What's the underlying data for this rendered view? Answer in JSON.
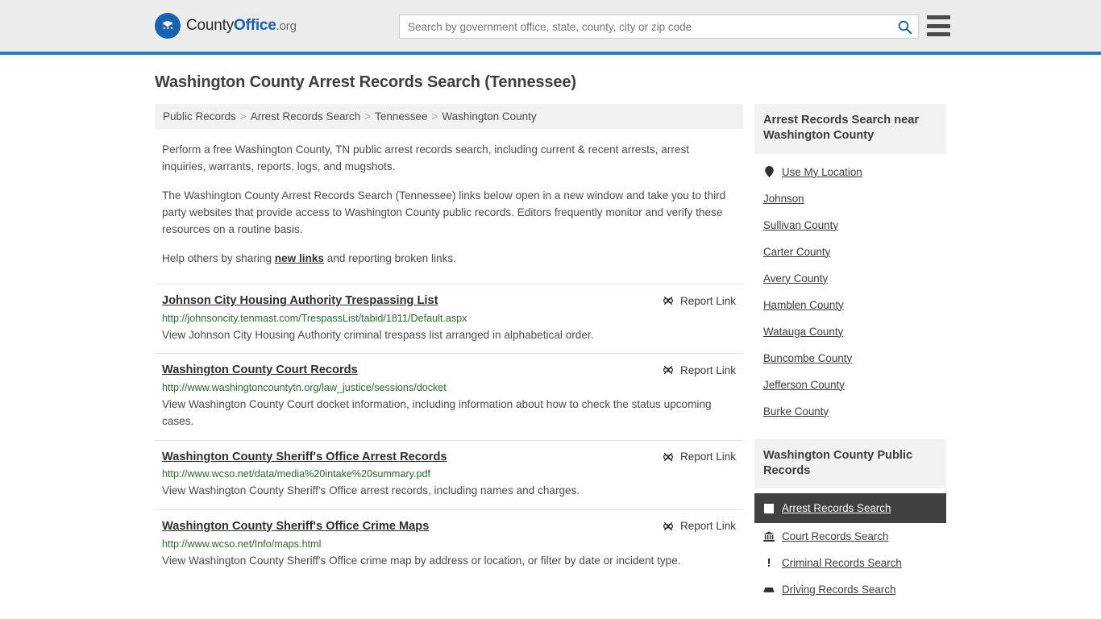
{
  "header": {
    "logo": {
      "part1": "County",
      "part2": "Office",
      "part3": ".org",
      "icon": "eagle-shield-icon"
    },
    "search": {
      "placeholder": "Search by government office, state, county, city or zip code",
      "value": "",
      "icon": "search-icon"
    },
    "menu_icon": "hamburger-menu-icon",
    "accent_color": "#3d72a4",
    "background_color": "#ececec"
  },
  "page": {
    "title": "Washington County Arrest Records Search (Tennessee)"
  },
  "breadcrumb": {
    "separator": ">",
    "items": [
      {
        "label": "Public Records"
      },
      {
        "label": "Arrest Records Search"
      },
      {
        "label": "Tennessee"
      },
      {
        "label": "Washington County"
      }
    ]
  },
  "intro": {
    "p1": "Perform a free Washington County, TN public arrest records search, including current & recent arrests, arrest inquiries, warrants, reports, logs, and mugshots.",
    "p2": "The Washington County Arrest Records Search (Tennessee) links below open in a new window and take you to third party websites that provide access to Washington County public records. Editors frequently monitor and verify these resources on a routine basis.",
    "p3_before": "Help others by sharing ",
    "p3_link": "new links",
    "p3_after": " and reporting broken links."
  },
  "results": {
    "report_label": "Report Link",
    "report_icon": "broken-link-icon",
    "items": [
      {
        "title": "Johnson City Housing Authority Trespassing List",
        "url": "http://johnsoncity.tenmast.com/TrespassList/tabid/1811/Default.aspx",
        "description": "View Johnson City Housing Authority criminal trespass list arranged in alphabetical order."
      },
      {
        "title": "Washington County Court Records",
        "url": "http://www.washingtoncountytn.org/law_justice/sessions/docket",
        "description": "View Washington County Court docket information, including information about how to check the status upcoming cases."
      },
      {
        "title": "Washington County Sheriff's Office Arrest Records",
        "url": "http://www.wcso.net/data/media%20intake%20summary.pdf",
        "description": "View Washington County Sheriff's Office arrest records, including names and charges."
      },
      {
        "title": "Washington County Sheriff's Office Crime Maps",
        "url": "http://www.wcso.net/Info/maps.html",
        "description": "View Washington County Sheriff's Office crime map by address or location, or filter by date or incident type."
      }
    ]
  },
  "sidebar": {
    "near": {
      "heading": "Arrest Records Search near Washington County",
      "use_my_location": {
        "label": "Use My Location",
        "icon": "map-pin-icon"
      },
      "items": [
        {
          "label": "Johnson"
        },
        {
          "label": "Sullivan County"
        },
        {
          "label": "Carter County"
        },
        {
          "label": "Avery County"
        },
        {
          "label": "Hamblen County"
        },
        {
          "label": "Watauga County"
        },
        {
          "label": "Buncombe County"
        },
        {
          "label": "Jefferson County"
        },
        {
          "label": "Burke County"
        }
      ]
    },
    "public_records": {
      "heading": "Washington County Public Records",
      "items": [
        {
          "label": "Arrest Records Search",
          "icon": "square-icon",
          "active": true
        },
        {
          "label": "Court Records Search",
          "icon": "courthouse-icon",
          "active": false
        },
        {
          "label": "Criminal Records Search",
          "icon": "exclamation-icon",
          "active": false
        },
        {
          "label": "Driving Records Search",
          "icon": "car-icon",
          "active": false
        }
      ]
    }
  }
}
